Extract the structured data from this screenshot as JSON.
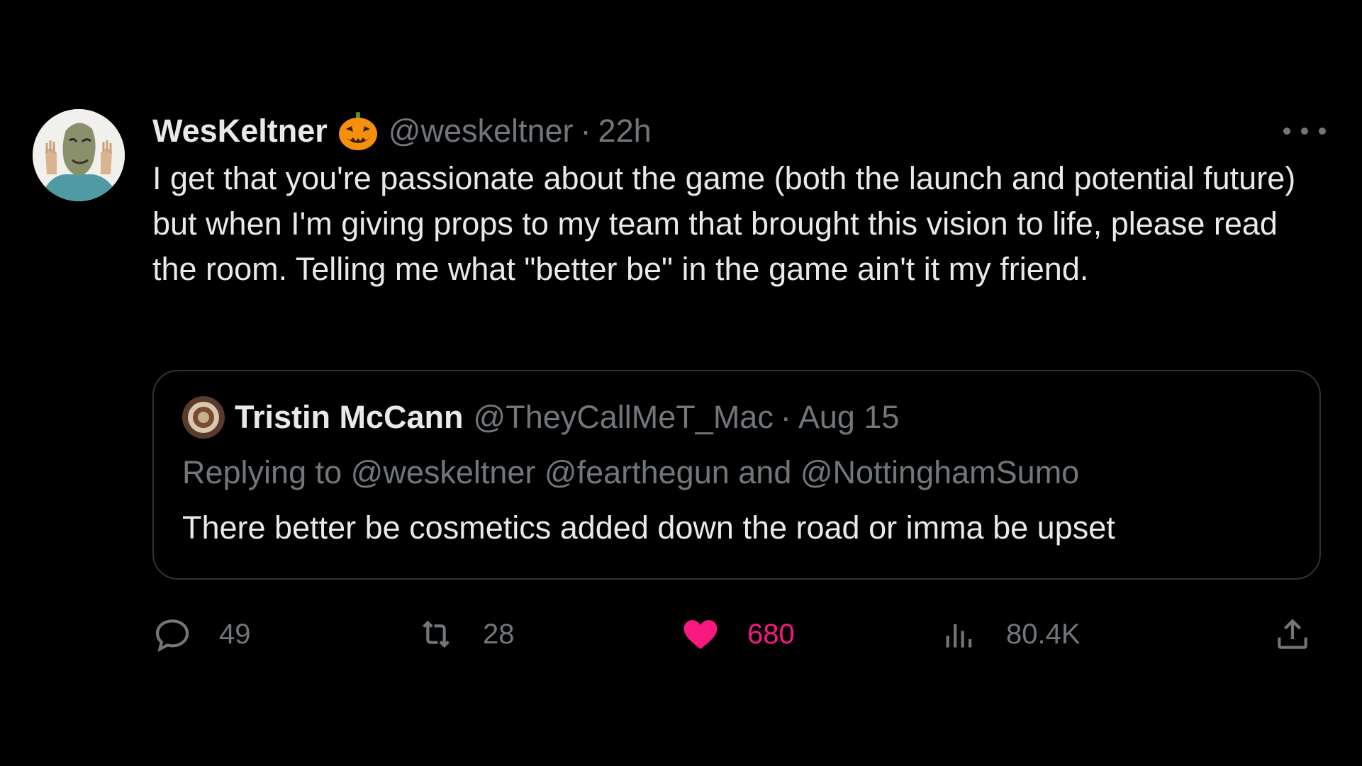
{
  "tweet": {
    "display_name": "WesKeltner",
    "name_emoji": "jack-o-lantern-emoji",
    "handle": "@weskeltner",
    "separator": "·",
    "time": "22h",
    "text": "I get that you're passionate about the game (both the launch and potential future) but when I'm giving props to my team that brought this vision to life, please read the room. Telling me what \"better be\" in the game ain't it my friend.",
    "more_icon": "more-dots-icon"
  },
  "quoted_tweet": {
    "display_name": "Tristin McCann",
    "handle": "@TheyCallMeT_Mac",
    "separator": "·",
    "date": "Aug 15",
    "replying_to": "Replying to @weskeltner @fearthegun and @NottinghamSumo",
    "text": "There better be cosmetics added down the road or imma be upset"
  },
  "actions": {
    "reply": {
      "icon": "reply-icon",
      "count": "49"
    },
    "retweet": {
      "icon": "retweet-icon",
      "count": "28"
    },
    "like": {
      "icon": "heart-icon",
      "count": "680",
      "active": true
    },
    "views": {
      "icon": "views-icon",
      "count": "80.4K"
    },
    "share": {
      "icon": "share-icon"
    }
  },
  "colors": {
    "background": "#000000",
    "text": "#e7e9ea",
    "muted": "#71767b",
    "border": "#2f3336",
    "like_active": "#f91880"
  }
}
